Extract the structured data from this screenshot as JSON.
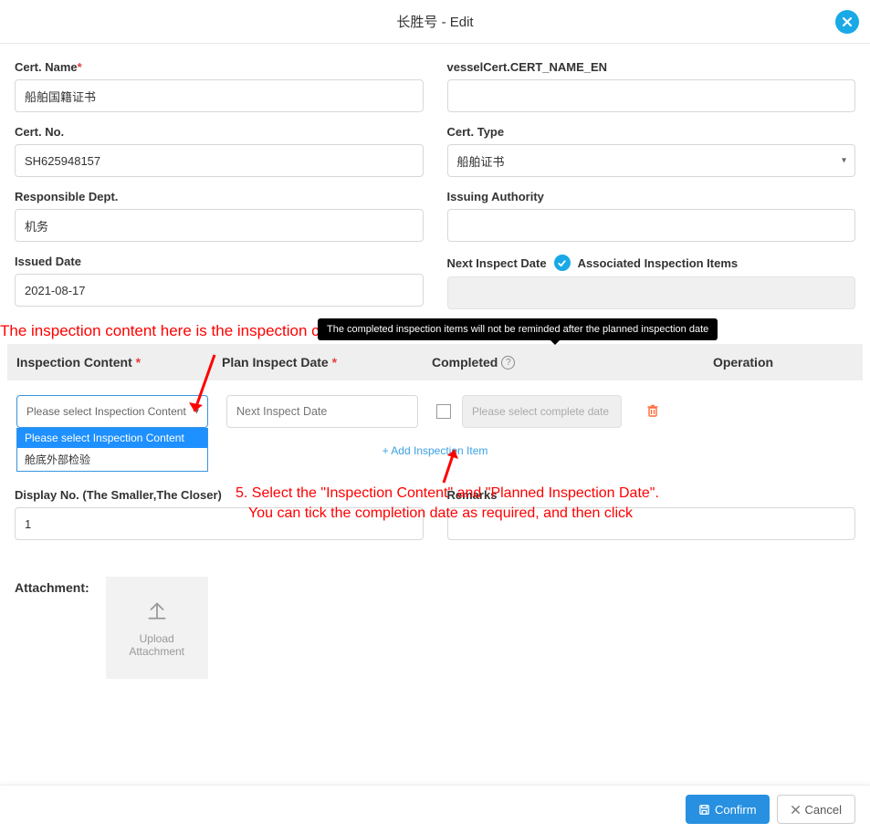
{
  "header": {
    "title": "长胜号 - Edit"
  },
  "fields": {
    "cert_name": {
      "label": "Cert. Name",
      "value": "船舶国籍证书"
    },
    "cert_name_en": {
      "label": "vesselCert.CERT_NAME_EN",
      "value": ""
    },
    "cert_no": {
      "label": "Cert. No.",
      "value": "SH625948157"
    },
    "cert_type": {
      "label": "Cert. Type",
      "value": "船舶证书"
    },
    "resp_dept": {
      "label": "Responsible Dept.",
      "value": "机务"
    },
    "issuing_auth": {
      "label": "Issuing Authority",
      "value": ""
    },
    "issued_date": {
      "label": "Issued Date",
      "value": "2021-08-17"
    },
    "next_inspect": {
      "label": "Next Inspect Date",
      "assoc_label": "Associated Inspection Items"
    },
    "display_no": {
      "label": "Display No.  (The Smaller,The Closer)",
      "value": "1"
    },
    "remarks": {
      "label": "Remarks"
    }
  },
  "annotation1": "The inspection content here is the inspection content that we have configured before",
  "tooltip": "The completed inspection items will not be reminded after the planned inspection date",
  "section_headers": {
    "inspection_content": "Inspection Content",
    "plan_inspect_date": "Plan Inspect Date",
    "completed": "Completed",
    "operation": "Operation"
  },
  "inspection_row": {
    "select_placeholder": "Please select Inspection Content",
    "plan_date_placeholder": "Next Inspect Date",
    "complete_date_placeholder": "Please select complete date",
    "options": [
      "Please select Inspection Content",
      "舱底外部检验"
    ]
  },
  "add_link": "+ Add Inspection Item",
  "annotation_step_l1": "5. Select the \"Inspection Content\" and \"Planned Inspection Date\".",
  "annotation_step_l2": "You can tick the completion date as required, and then click",
  "attachment": {
    "label": "Attachment:",
    "upload_l1": "Upload",
    "upload_l2": "Attachment"
  },
  "footer": {
    "confirm": "Confirm",
    "cancel": "Cancel"
  }
}
